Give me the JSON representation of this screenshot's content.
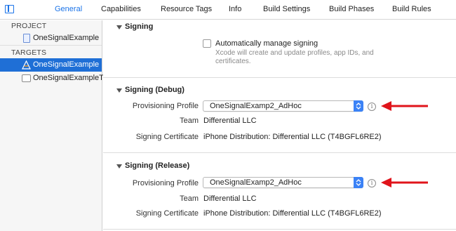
{
  "tabs": [
    {
      "label": "General",
      "active": true
    },
    {
      "label": "Capabilities",
      "active": false
    },
    {
      "label": "Resource Tags",
      "active": false
    },
    {
      "label": "Info",
      "active": false
    },
    {
      "label": "Build Settings",
      "active": false
    },
    {
      "label": "Build Phases",
      "active": false
    },
    {
      "label": "Build Rules",
      "active": false
    }
  ],
  "sidebar": {
    "project_header": "PROJECT",
    "project_item": "OneSignalExample",
    "targets_header": "TARGETS",
    "targets": [
      {
        "label": "OneSignalExample",
        "selected": true,
        "icon": "app-target-icon"
      },
      {
        "label": "OneSignalExampleT...",
        "selected": false,
        "icon": "test-target-icon"
      }
    ]
  },
  "signing": {
    "title": "Signing",
    "auto_label": "Automatically manage signing",
    "auto_checked": false,
    "auto_hint": "Xcode will create and update profiles, app IDs, and certificates."
  },
  "debug": {
    "title": "Signing (Debug)",
    "profile_label": "Provisioning Profile",
    "profile_value": "OneSignalExamp2_AdHoc",
    "team_label": "Team",
    "team_value": "Differential LLC",
    "cert_label": "Signing Certificate",
    "cert_value": "iPhone Distribution: Differential LLC (T4BGFL6RE2)"
  },
  "release": {
    "title": "Signing (Release)",
    "profile_label": "Provisioning Profile",
    "profile_value": "OneSignalExamp2_AdHoc",
    "team_label": "Team",
    "team_value": "Differential LLC",
    "cert_label": "Signing Certificate",
    "cert_value": "iPhone Distribution: Differential LLC (T4BGFL6RE2)"
  },
  "colors": {
    "accent": "#1a73e8",
    "selection": "#1f6fd6",
    "annotation_arrow": "#e0141b"
  }
}
